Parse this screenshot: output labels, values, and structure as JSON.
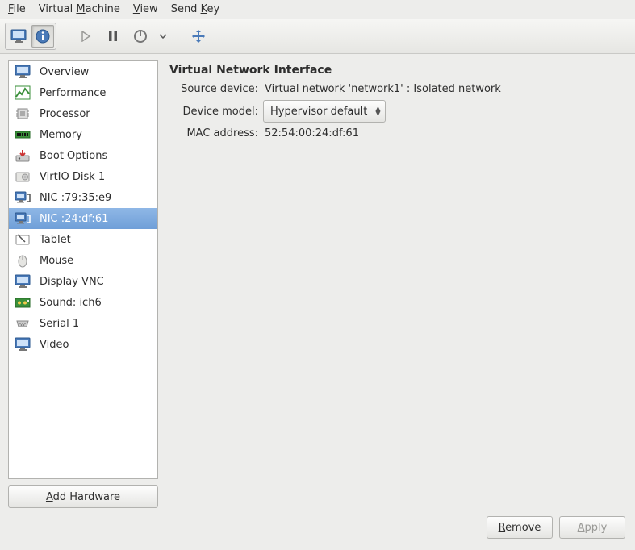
{
  "menu": {
    "file": "File",
    "vm": "Virtual Machine",
    "view": "View",
    "sendkey": "Send Key"
  },
  "toolbar": {
    "console_tip": "Console",
    "details_tip": "Details",
    "run_tip": "Run",
    "pause_tip": "Pause",
    "power_tip": "Shut Down",
    "fullscreen_tip": "Fullscreen"
  },
  "sidebar": {
    "items": [
      {
        "label": "Overview",
        "icon": "monitor"
      },
      {
        "label": "Performance",
        "icon": "perf"
      },
      {
        "label": "Processor",
        "icon": "cpu"
      },
      {
        "label": "Memory",
        "icon": "memory"
      },
      {
        "label": "Boot Options",
        "icon": "boot"
      },
      {
        "label": "VirtIO Disk 1",
        "icon": "disk"
      },
      {
        "label": "NIC :79:35:e9",
        "icon": "nic"
      },
      {
        "label": "NIC :24:df:61",
        "icon": "nic"
      },
      {
        "label": "Tablet",
        "icon": "tablet"
      },
      {
        "label": "Mouse",
        "icon": "mouse"
      },
      {
        "label": "Display VNC",
        "icon": "monitor"
      },
      {
        "label": "Sound: ich6",
        "icon": "sound"
      },
      {
        "label": "Serial 1",
        "icon": "serial"
      },
      {
        "label": "Video",
        "icon": "monitor"
      }
    ],
    "selected_index": 7,
    "add_hardware_label": "Add Hardware"
  },
  "main": {
    "title": "Virtual Network Interface",
    "source_device_label": "Source device:",
    "source_device_value": "Virtual network 'network1' : Isolated network",
    "device_model_label": "Device model:",
    "device_model_value": "Hypervisor default",
    "mac_label": "MAC address:",
    "mac_value": "52:54:00:24:df:61"
  },
  "footer": {
    "remove_label": "Remove",
    "apply_label": "Apply"
  }
}
